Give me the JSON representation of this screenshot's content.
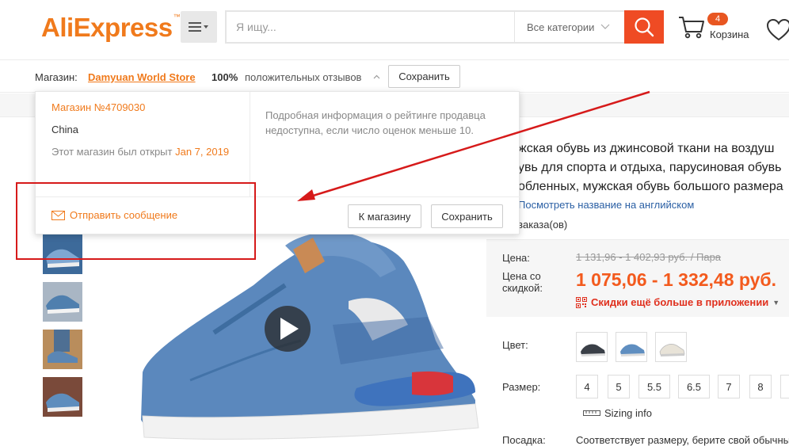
{
  "header": {
    "logo": "AliExpress",
    "logo_tm": "™",
    "search_placeholder": "Я ищу...",
    "category_label": "Все категории",
    "cart_count": "4",
    "cart_label": "Корзина",
    "accent": "#ef4b24"
  },
  "storebar": {
    "shop_label": "Магазин:",
    "store_name": "Damyuan World Store",
    "rating_percent": "100%",
    "rating_label": "положительных отзывов",
    "save_label": "Сохранить"
  },
  "popover": {
    "store_id": "Магазин №4709030",
    "country": "China",
    "opened_prefix": "Этот магазин был открыт",
    "opened_date": "Jan 7, 2019",
    "info_text": "Подробная информация о рейтинге продавца недоступна, если число оценок меньше 10.",
    "message_label": "Отправить сообщение",
    "to_store_label": "К магазину",
    "save_label": "Сохранить"
  },
  "product": {
    "title_lines": [
      "жская обувь из джинсовой ткани на воздуш",
      "увь для спорта и отдыха, парусиновая обувь",
      "обленных, мужская обувь большого размера"
    ],
    "translate_label": "Посмотреть название на английском",
    "orders_label": "заказа(ов)",
    "price_label": "Цена:",
    "old_price": "1 131,96 - 1 402,93 руб. / Пара",
    "discount_label_1": "Цена со",
    "discount_label_2": "скидкой:",
    "new_price": "1 075,06 - 1 332,48 руб.",
    "app_deal": "Скидки ещё больше в приложении",
    "color_label": "Цвет:",
    "size_label": "Размер:",
    "sizes": [
      "4",
      "5",
      "5.5",
      "6.5",
      "7",
      "8"
    ],
    "sizing_info": "Sizing info",
    "fit_label": "Посадка:",
    "fit_value": "Соответствует размеру, берите свой обычны"
  }
}
